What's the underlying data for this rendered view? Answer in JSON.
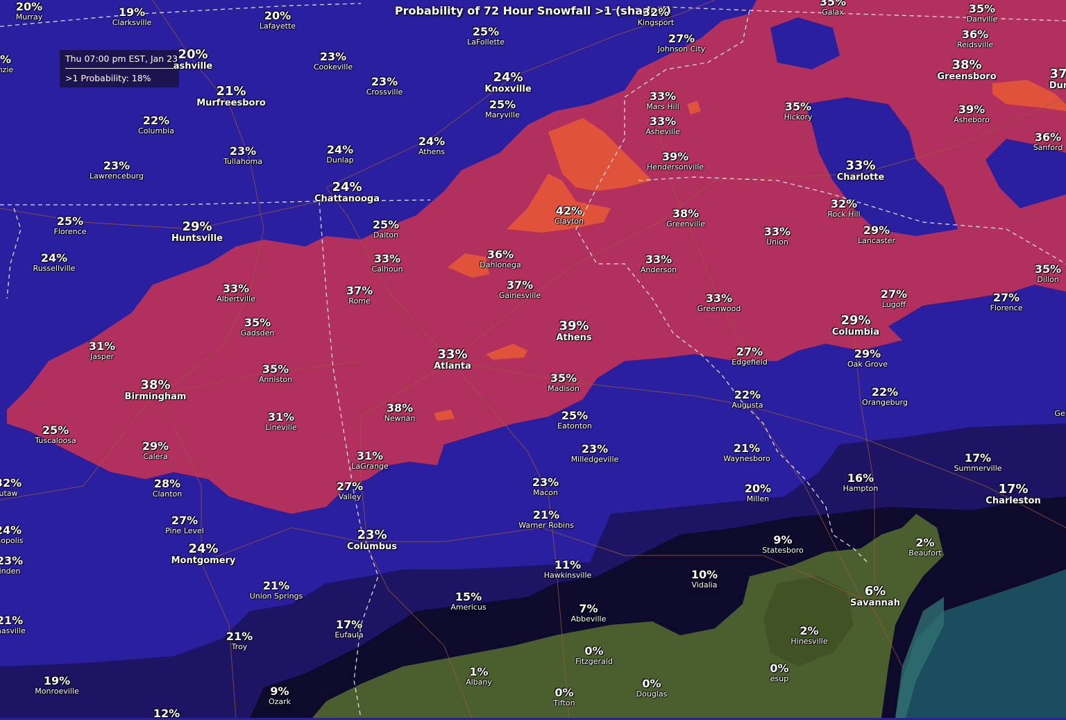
{
  "title": "Probability of 72 Hour Snowfall >1 (shaded)",
  "tooltip": {
    "time": "Thu 07:00 pm EST, Jan 23",
    "value": ">1 Probability: 18%"
  },
  "colors": {
    "low_0": "#0d0a2b",
    "low_5": "#1d1463",
    "low_15": "#2a1f9e",
    "mid_25": "#b2305e",
    "high_40": "#e0533a",
    "ocean": "#1c4d5e",
    "land": "#4b5e2d",
    "roads": "#9a5a3c",
    "borders": "#ffffff"
  },
  "cities": [
    {
      "pct": "20%",
      "name": "Murray",
      "big": false
    },
    {
      "pct": "19%",
      "name": "Clarksville",
      "big": false
    },
    {
      "pct": "20%",
      "name": "Lafayette",
      "big": false
    },
    {
      "pct": "32%",
      "name": "Kingsport",
      "big": false
    },
    {
      "pct": "35%",
      "name": "Galax",
      "big": false
    },
    {
      "pct": "35%",
      "name": "Danville",
      "big": false
    },
    {
      "pct": "20%",
      "name": "ashville",
      "big": true
    },
    {
      "pct": "25%",
      "name": "LaFollette",
      "big": false
    },
    {
      "pct": "27%",
      "name": "Johnson City",
      "big": false
    },
    {
      "pct": "36%",
      "name": "Reidsville",
      "big": false
    },
    {
      "pct": "%",
      "name": "nzie",
      "big": false
    },
    {
      "pct": "23%",
      "name": "Cookeville",
      "big": false
    },
    {
      "pct": "38%",
      "name": "Greensboro",
      "big": true
    },
    {
      "pct": "37",
      "name": "Dur",
      "big": true
    },
    {
      "pct": "24%",
      "name": "Knoxville",
      "big": true
    },
    {
      "pct": "23%",
      "name": "Crossville",
      "big": false
    },
    {
      "pct": "21%",
      "name": "Murfreesboro",
      "big": true
    },
    {
      "pct": "33%",
      "name": "Mars Hill",
      "big": false
    },
    {
      "pct": "25%",
      "name": "Maryville",
      "big": false
    },
    {
      "pct": "35%",
      "name": "Hickory",
      "big": false
    },
    {
      "pct": "39%",
      "name": "Asheboro",
      "big": false
    },
    {
      "pct": "22%",
      "name": "Columbia",
      "big": false
    },
    {
      "pct": "33%",
      "name": "Asheville",
      "big": false
    },
    {
      "pct": "36%",
      "name": "Sanford",
      "big": false
    },
    {
      "pct": "24%",
      "name": "Athens",
      "big": false
    },
    {
      "pct": "23%",
      "name": "Tullahoma",
      "big": false
    },
    {
      "pct": "24%",
      "name": "Dunlap",
      "big": false
    },
    {
      "pct": "39%",
      "name": "Hendersonville",
      "big": false
    },
    {
      "pct": "33%",
      "name": "Charlotte",
      "big": true
    },
    {
      "pct": "23%",
      "name": "Lawrenceburg",
      "big": false
    },
    {
      "pct": "24%",
      "name": "Chattanooga",
      "big": true
    },
    {
      "pct": "32%",
      "name": "Rock Hill",
      "big": false
    },
    {
      "pct": "42%",
      "name": "Clayton",
      "big": false
    },
    {
      "pct": "38%",
      "name": "Greenville",
      "big": false
    },
    {
      "pct": "25%",
      "name": "Florence",
      "big": false
    },
    {
      "pct": "29%",
      "name": "Huntsville",
      "big": true
    },
    {
      "pct": "25%",
      "name": "Dalton",
      "big": false
    },
    {
      "pct": "33%",
      "name": "Union",
      "big": false
    },
    {
      "pct": "29%",
      "name": "Lancaster",
      "big": false
    },
    {
      "pct": "24%",
      "name": "Russellville",
      "big": false
    },
    {
      "pct": "36%",
      "name": "Dahlonega",
      "big": false
    },
    {
      "pct": "33%",
      "name": "Calhoun",
      "big": false
    },
    {
      "pct": "33%",
      "name": "Anderson",
      "big": false
    },
    {
      "pct": "35%",
      "name": "Dillon",
      "big": false
    },
    {
      "pct": "33%",
      "name": "Albertville",
      "big": false
    },
    {
      "pct": "37%",
      "name": "Rome",
      "big": false
    },
    {
      "pct": "37%",
      "name": "Gainesville",
      "big": false
    },
    {
      "pct": "27%",
      "name": "Lugoff",
      "big": false
    },
    {
      "pct": "27%",
      "name": "Florence",
      "big": false
    },
    {
      "pct": "33%",
      "name": "Greenwood",
      "big": false
    },
    {
      "pct": "35%",
      "name": "Gadsden",
      "big": false
    },
    {
      "pct": "39%",
      "name": "Athens",
      "big": true
    },
    {
      "pct": "29%",
      "name": "Columbia",
      "big": true
    },
    {
      "pct": "31%",
      "name": "Jasper",
      "big": false
    },
    {
      "pct": "27%",
      "name": "Edgefield",
      "big": false
    },
    {
      "pct": "33%",
      "name": "Atlanta",
      "big": true
    },
    {
      "pct": "29%",
      "name": "Oak Grove",
      "big": false
    },
    {
      "pct": "35%",
      "name": "Anniston",
      "big": false
    },
    {
      "pct": "35%",
      "name": "Madison",
      "big": false
    },
    {
      "pct": "38%",
      "name": "Birmingham",
      "big": true
    },
    {
      "pct": "22%",
      "name": "Augusta",
      "big": false
    },
    {
      "pct": "22%",
      "name": "Orangeburg",
      "big": false
    },
    {
      "pct": "38%",
      "name": "Newnan",
      "big": false
    },
    {
      "pct": "25%",
      "name": "Eatonton",
      "big": false
    },
    {
      "pct": "",
      "name": "Ge",
      "big": false
    },
    {
      "pct": "31%",
      "name": "Lineville",
      "big": false
    },
    {
      "pct": "25%",
      "name": "Tuscaloosa",
      "big": false
    },
    {
      "pct": "29%",
      "name": "Calera",
      "big": false
    },
    {
      "pct": "23%",
      "name": "Milledgeville",
      "big": false
    },
    {
      "pct": "21%",
      "name": "Waynesboro",
      "big": false
    },
    {
      "pct": "31%",
      "name": "LaGrange",
      "big": false
    },
    {
      "pct": "17%",
      "name": "Summerville",
      "big": false
    },
    {
      "pct": "32%",
      "name": "utaw",
      "big": false
    },
    {
      "pct": "28%",
      "name": "Clanton",
      "big": false
    },
    {
      "pct": "16%",
      "name": "Hampton",
      "big": false
    },
    {
      "pct": "23%",
      "name": "Macon",
      "big": false
    },
    {
      "pct": "27%",
      "name": "Valley",
      "big": false
    },
    {
      "pct": "20%",
      "name": "Millen",
      "big": false
    },
    {
      "pct": "17%",
      "name": "Charleston",
      "big": true
    },
    {
      "pct": "27%",
      "name": "Pine Level",
      "big": false
    },
    {
      "pct": "21%",
      "name": "Warner Robins",
      "big": false
    },
    {
      "pct": "24%",
      "name": "mopolis",
      "big": false
    },
    {
      "pct": "23%",
      "name": "Columbus",
      "big": true
    },
    {
      "pct": "9%",
      "name": "Statesboro",
      "big": false
    },
    {
      "pct": "2%",
      "name": "Beaufort",
      "big": false
    },
    {
      "pct": "24%",
      "name": "Montgomery",
      "big": true
    },
    {
      "pct": "23%",
      "name": "inden",
      "big": false
    },
    {
      "pct": "11%",
      "name": "Hawkinsville",
      "big": false
    },
    {
      "pct": "10%",
      "name": "Vidalia",
      "big": false
    },
    {
      "pct": "21%",
      "name": "Union Springs",
      "big": false
    },
    {
      "pct": "6%",
      "name": "Savannah",
      "big": true
    },
    {
      "pct": "15%",
      "name": "Americus",
      "big": false
    },
    {
      "pct": "7%",
      "name": "Abbeville",
      "big": false
    },
    {
      "pct": "21%",
      "name": "masville",
      "big": false
    },
    {
      "pct": "17%",
      "name": "Eufaula",
      "big": false
    },
    {
      "pct": "2%",
      "name": "Hinesville",
      "big": false
    },
    {
      "pct": "21%",
      "name": "Troy",
      "big": false
    },
    {
      "pct": "0%",
      "name": "Fitzgerald",
      "big": false
    },
    {
      "pct": "1%",
      "name": "Albany",
      "big": false
    },
    {
      "pct": "0%",
      "name": "esup",
      "big": false
    },
    {
      "pct": "19%",
      "name": "Monroeville",
      "big": false
    },
    {
      "pct": "9%",
      "name": "Ozark",
      "big": false
    },
    {
      "pct": "0%",
      "name": "Douglas",
      "big": false
    },
    {
      "pct": "0%",
      "name": "Tifton",
      "big": false
    },
    {
      "pct": "12%",
      "name": "",
      "big": false
    }
  ]
}
